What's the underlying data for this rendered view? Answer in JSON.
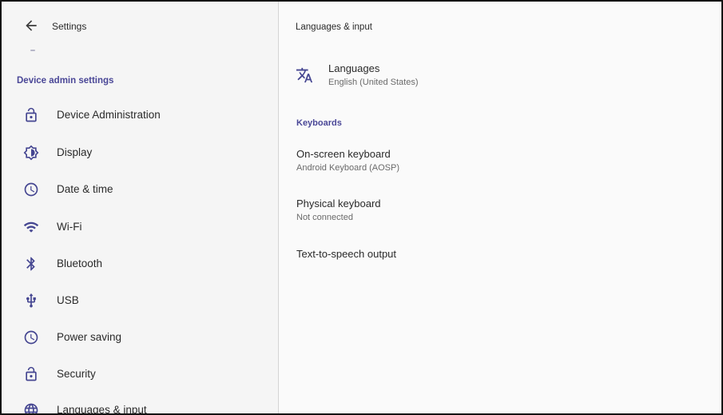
{
  "header": {
    "title": "Settings"
  },
  "sidebar": {
    "section_title": "Device admin settings",
    "items": [
      {
        "label": "Device Administration",
        "icon": "lock-open-icon"
      },
      {
        "label": "Display",
        "icon": "brightness-icon"
      },
      {
        "label": "Date & time",
        "icon": "clock-icon"
      },
      {
        "label": "Wi-Fi",
        "icon": "wifi-icon"
      },
      {
        "label": "Bluetooth",
        "icon": "bluetooth-icon"
      },
      {
        "label": "USB",
        "icon": "usb-icon"
      },
      {
        "label": "Power saving",
        "icon": "clock-icon"
      },
      {
        "label": "Security",
        "icon": "lock-open-icon"
      },
      {
        "label": "Languages & input",
        "icon": "globe-icon"
      }
    ]
  },
  "main": {
    "title": "Languages & input",
    "languages": {
      "title": "Languages",
      "summary": "English (United States)",
      "icon": "translate-icon"
    },
    "keyboards": {
      "header": "Keyboards",
      "items": [
        {
          "title": "On-screen keyboard",
          "summary": "Android Keyboard (AOSP)"
        },
        {
          "title": "Physical keyboard",
          "summary": "Not connected"
        },
        {
          "title": "Text-to-speech output",
          "summary": ""
        }
      ]
    }
  },
  "colors": {
    "accent": "#4a4797",
    "icon": "#454691",
    "sidebar_bg": "#f5f5f5",
    "content_bg": "#fafafa"
  }
}
